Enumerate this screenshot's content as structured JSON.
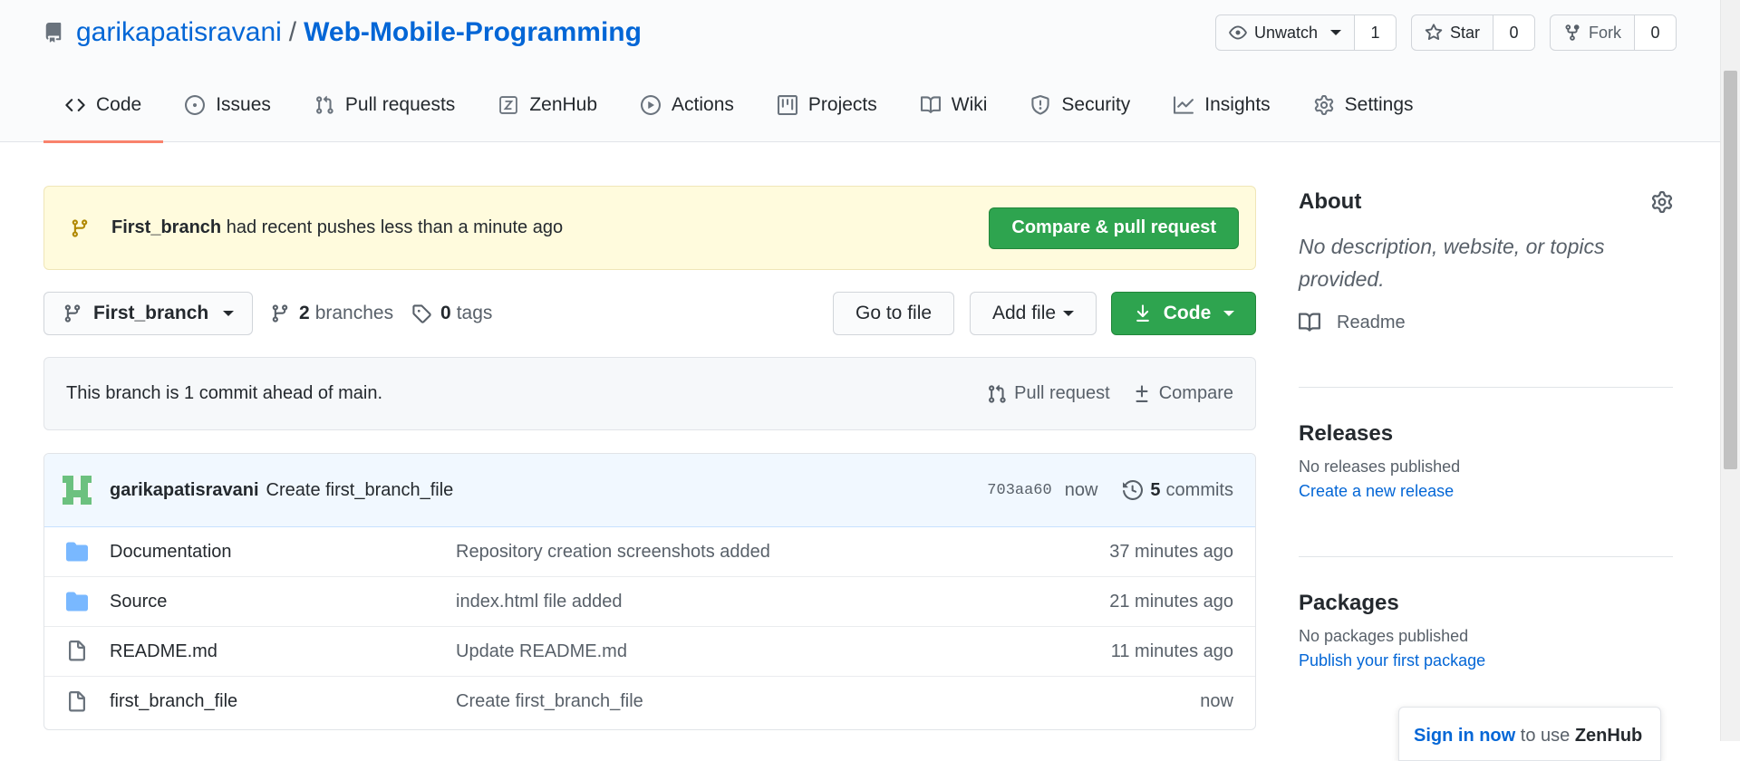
{
  "repo": {
    "owner": "garikapatisravani",
    "separator": "/",
    "name": "Web-Mobile-Programming"
  },
  "actions": {
    "watch": {
      "label": "Unwatch",
      "count": "1"
    },
    "star": {
      "label": "Star",
      "count": "0"
    },
    "fork": {
      "label": "Fork",
      "count": "0"
    }
  },
  "tabs": [
    {
      "label": "Code",
      "icon": "code-icon"
    },
    {
      "label": "Issues",
      "icon": "issue-icon"
    },
    {
      "label": "Pull requests",
      "icon": "pull-request-icon"
    },
    {
      "label": "ZenHub",
      "icon": "zenhub-icon"
    },
    {
      "label": "Actions",
      "icon": "play-icon"
    },
    {
      "label": "Projects",
      "icon": "project-icon"
    },
    {
      "label": "Wiki",
      "icon": "book-icon"
    },
    {
      "label": "Security",
      "icon": "shield-icon"
    },
    {
      "label": "Insights",
      "icon": "graph-icon"
    },
    {
      "label": "Settings",
      "icon": "gear-icon"
    }
  ],
  "banner": {
    "branch": "First_branch",
    "message": "had recent pushes less than a minute ago",
    "button": "Compare & pull request"
  },
  "toolbar": {
    "branch": "First_branch",
    "branches_count": "2",
    "branches_label": "branches",
    "tags_count": "0",
    "tags_label": "tags",
    "go_to_file": "Go to file",
    "add_file": "Add file",
    "code": "Code"
  },
  "ahead": {
    "message": "This branch is 1 commit ahead of main.",
    "pull_request": "Pull request",
    "compare": "Compare"
  },
  "commit": {
    "author": "garikapatisravani",
    "message": "Create first_branch_file",
    "sha": "703aa60",
    "age": "now",
    "commits_count": "5",
    "commits_label": "commits"
  },
  "files": [
    {
      "type": "folder",
      "name": "Documentation",
      "message": "Repository creation screenshots added",
      "time": "37 minutes ago"
    },
    {
      "type": "folder",
      "name": "Source",
      "message": "index.html file added",
      "time": "21 minutes ago"
    },
    {
      "type": "file",
      "name": "README.md",
      "message": "Update README.md",
      "time": "11 minutes ago"
    },
    {
      "type": "file",
      "name": "first_branch_file",
      "message": "Create first_branch_file",
      "time": "now"
    }
  ],
  "sidebar": {
    "about": {
      "title": "About",
      "description": "No description, website, or topics provided.",
      "readme": "Readme"
    },
    "releases": {
      "title": "Releases",
      "status": "No releases published",
      "link": "Create a new release"
    },
    "packages": {
      "title": "Packages",
      "status": "No packages published",
      "link": "Publish your first package"
    }
  },
  "signin_popup": {
    "link": "Sign in now",
    "text": "to use",
    "brand": "ZenHub"
  },
  "colors": {
    "primary_green": "#2ea44f",
    "link_blue": "#0366d6",
    "tab_underline": "#f9826c",
    "banner_bg": "#fffbdd",
    "folder": "#79b8ff"
  }
}
